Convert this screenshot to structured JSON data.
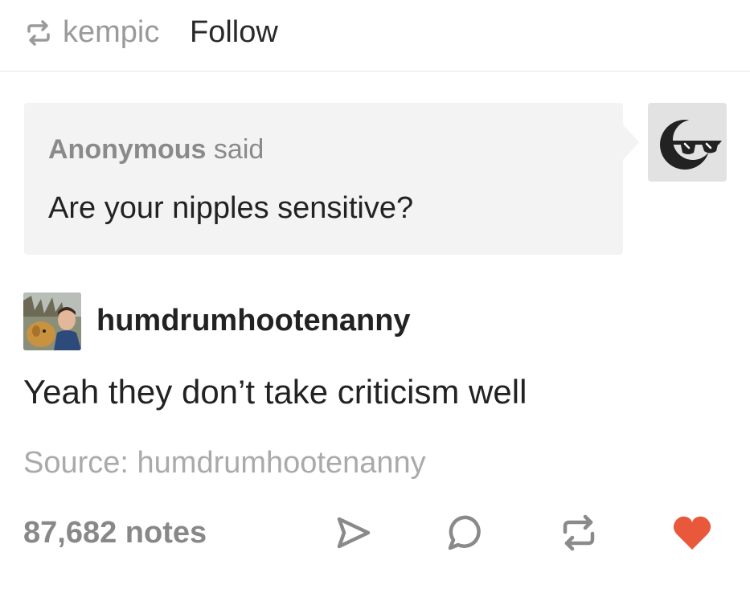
{
  "header": {
    "reblogger": "kempic",
    "follow_label": "Follow"
  },
  "ask": {
    "asker": "Anonymous",
    "said": "said",
    "question": "Are your nipples sensitive?"
  },
  "answer": {
    "username": "humdrumhootenanny",
    "text": "Yeah they don’t take criticism well"
  },
  "source": {
    "text": "Source: humdrumhootenanny"
  },
  "footer": {
    "notes": "87,682 notes",
    "icons": [
      "share-icon",
      "comment-icon",
      "reblog-icon",
      "like-icon"
    ]
  },
  "colors": {
    "like": "#e9583a",
    "muted": "#9a9a9a",
    "ask_bg": "#f3f3f3"
  }
}
